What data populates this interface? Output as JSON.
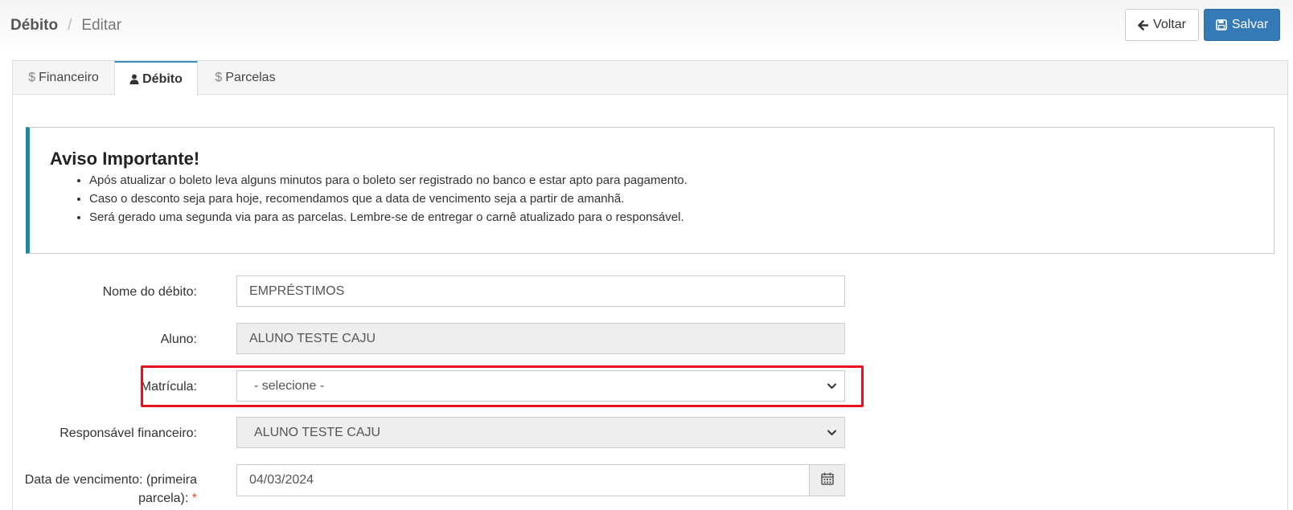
{
  "breadcrumb": {
    "current": "Débito",
    "separator": "/",
    "sub": "Editar"
  },
  "toolbar": {
    "back_label": "Voltar",
    "save_label": "Salvar"
  },
  "tabs": [
    {
      "label": "Financeiro",
      "icon": "dollar-icon",
      "active": false
    },
    {
      "label": "Débito",
      "icon": "user-icon",
      "active": true
    },
    {
      "label": "Parcelas",
      "icon": "dollar-icon",
      "active": false
    }
  ],
  "notice": {
    "title": "Aviso Importante!",
    "items": [
      "Após atualizar o boleto leva alguns minutos para o boleto ser registrado no banco e estar apto para pagamento.",
      "Caso o desconto seja para hoje, recomendamos que a data de vencimento seja a partir de amanhã.",
      "Será gerado uma segunda via para as parcelas. Lembre-se de entregar o carnê atualizado para o responsável."
    ]
  },
  "form": {
    "nome": {
      "label": "Nome do débito:",
      "value": "EMPRÉSTIMOS"
    },
    "aluno": {
      "label": "Aluno:",
      "value": "ALUNO TESTE CAJU"
    },
    "matricula": {
      "label": "Matrícula:",
      "value": "- selecione -"
    },
    "responsavel": {
      "label": "Responsável financeiro:",
      "value": "ALUNO TESTE CAJU"
    },
    "vencimento": {
      "label_line1": "Data de vencimento: (primeira",
      "label_line2": "parcela):",
      "required_mark": "*",
      "value": "04/03/2024"
    }
  },
  "colors": {
    "primary": "#337ab7",
    "callout_accent": "#1e8aa0",
    "highlight": "#e8121b",
    "required": "#dd4b39"
  }
}
